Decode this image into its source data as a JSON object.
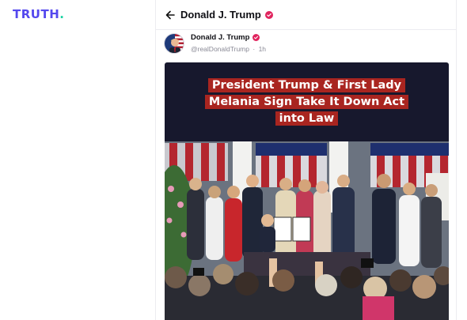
{
  "app": {
    "logo_text": "TRUTH",
    "logo_dot": "."
  },
  "header": {
    "title": "Donald J. Trump",
    "back_icon": "arrow-left-icon",
    "verified_icon": "verified-badge-icon"
  },
  "post": {
    "author_name": "Donald J. Trump",
    "handle": "@realDonaldTrump",
    "separator": "·",
    "time": "1h",
    "media": {
      "headline_lines": [
        "President Trump &  First Lady",
        "Melania Sign Take It Down Act",
        "into Law"
      ]
    }
  },
  "colors": {
    "brand": "#5448ee",
    "brand_dot": "#19d3a2",
    "verified": "#e0245e",
    "headline_bg": "#a92520",
    "media_bg": "#17182d"
  }
}
